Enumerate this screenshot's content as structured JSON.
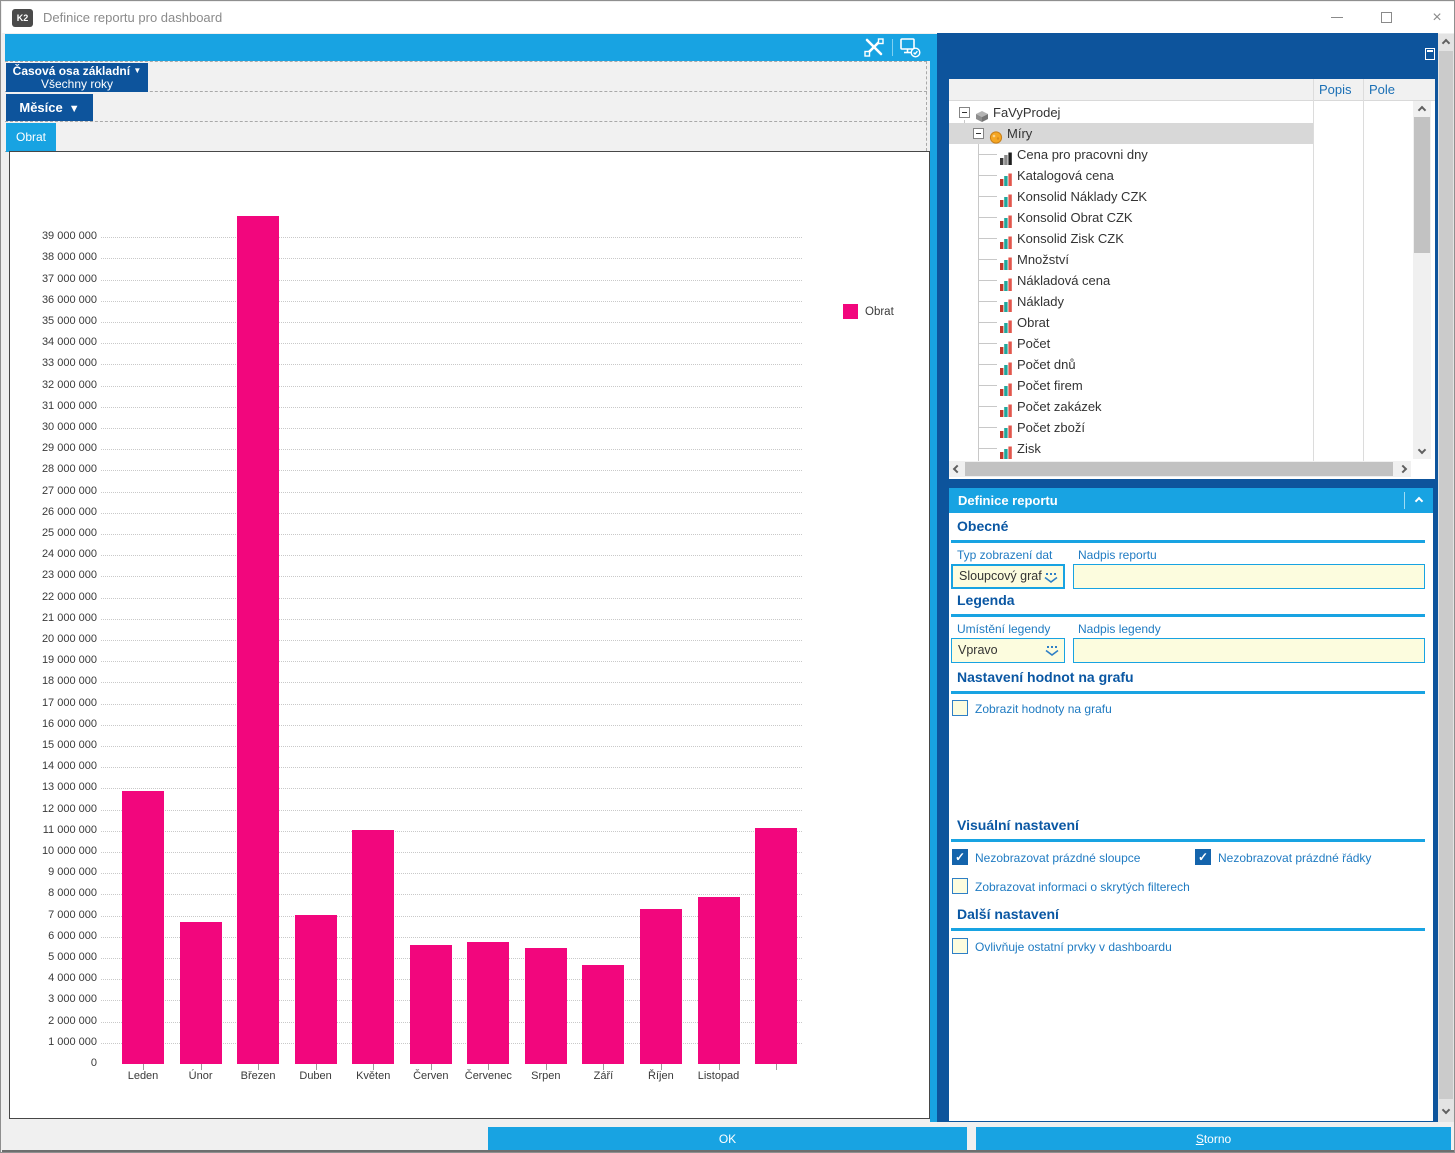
{
  "window": {
    "title": "Definice reportu pro dashboard",
    "logo_text": "K2"
  },
  "left_panel": {
    "toolbar_icons": [
      "crossed-tools-icon",
      "monitor-check-icon"
    ],
    "time_axis": {
      "line1": "Časová osa základní",
      "line2": "Všechny roky"
    },
    "months_label": "Měsíce",
    "measure_tab": "Obrat"
  },
  "chart_data": {
    "type": "bar",
    "title": "",
    "categories": [
      "Leden",
      "Únor",
      "Březen",
      "Duben",
      "Květen",
      "Červen",
      "Červenec",
      "Srpen",
      "Září",
      "Říjen",
      "Listopad",
      ""
    ],
    "series": [
      {
        "name": "Obrat",
        "color": "#F2067D",
        "values": [
          12880000,
          6720000,
          40000000,
          7040000,
          11040000,
          5600000,
          5740000,
          5470000,
          4650000,
          7300000,
          7900000,
          11130000
        ]
      }
    ],
    "ylim": [
      0,
      40000000
    ],
    "y_tick_step": 1000000,
    "y_max_tick": 39000000,
    "grid": "dotted-horizontal",
    "legend_position": "right",
    "legend_label": "Obrat"
  },
  "tree": {
    "columns": {
      "popis": "Popis",
      "pole": "Pole"
    },
    "root": "FaVyProdej",
    "group": "Míry",
    "items": [
      "Cena pro pracovni dny",
      "Katalogová cena",
      "Konsolid Náklady CZK",
      "Konsolid Obrat CZK",
      "Konsolid Zisk CZK",
      "Množství",
      "Nákladová cena",
      "Náklady",
      "Obrat",
      "Počet",
      "Počet dnů",
      "Počet firem",
      "Počet zakázek",
      "Počet zboží",
      "Zisk"
    ]
  },
  "definition_panel": {
    "title": "Definice reportu",
    "general": {
      "heading": "Obecné",
      "type_label": "Typ zobrazení dat",
      "type_value": "Sloupcový graf",
      "report_title_label": "Nadpis reportu",
      "report_title_value": ""
    },
    "legend": {
      "heading": "Legenda",
      "position_label": "Umístění legendy",
      "position_value": "Vpravo",
      "legend_title_label": "Nadpis legendy",
      "legend_title_value": ""
    },
    "values": {
      "heading": "Nastavení hodnot na grafu",
      "show_values_label": "Zobrazit hodnoty na grafu",
      "show_values_checked": false
    },
    "visual": {
      "heading": "Visuální nastavení",
      "hide_empty_columns_label": "Nezobrazovat prázdné sloupce",
      "hide_empty_columns_checked": true,
      "hide_empty_rows_label": "Nezobrazovat prázdné řádky",
      "hide_empty_rows_checked": true,
      "hidden_filters_label": "Zobrazovat informaci o skrytých filterech",
      "hidden_filters_checked": false
    },
    "other": {
      "heading": "Další nastavení",
      "affects_label": "Ovlivňuje ostatní prvky v dashboardu",
      "affects_checked": false
    }
  },
  "footer": {
    "ok_label": "OK",
    "storno_label": "Storno",
    "storno_accesskey": "S"
  }
}
